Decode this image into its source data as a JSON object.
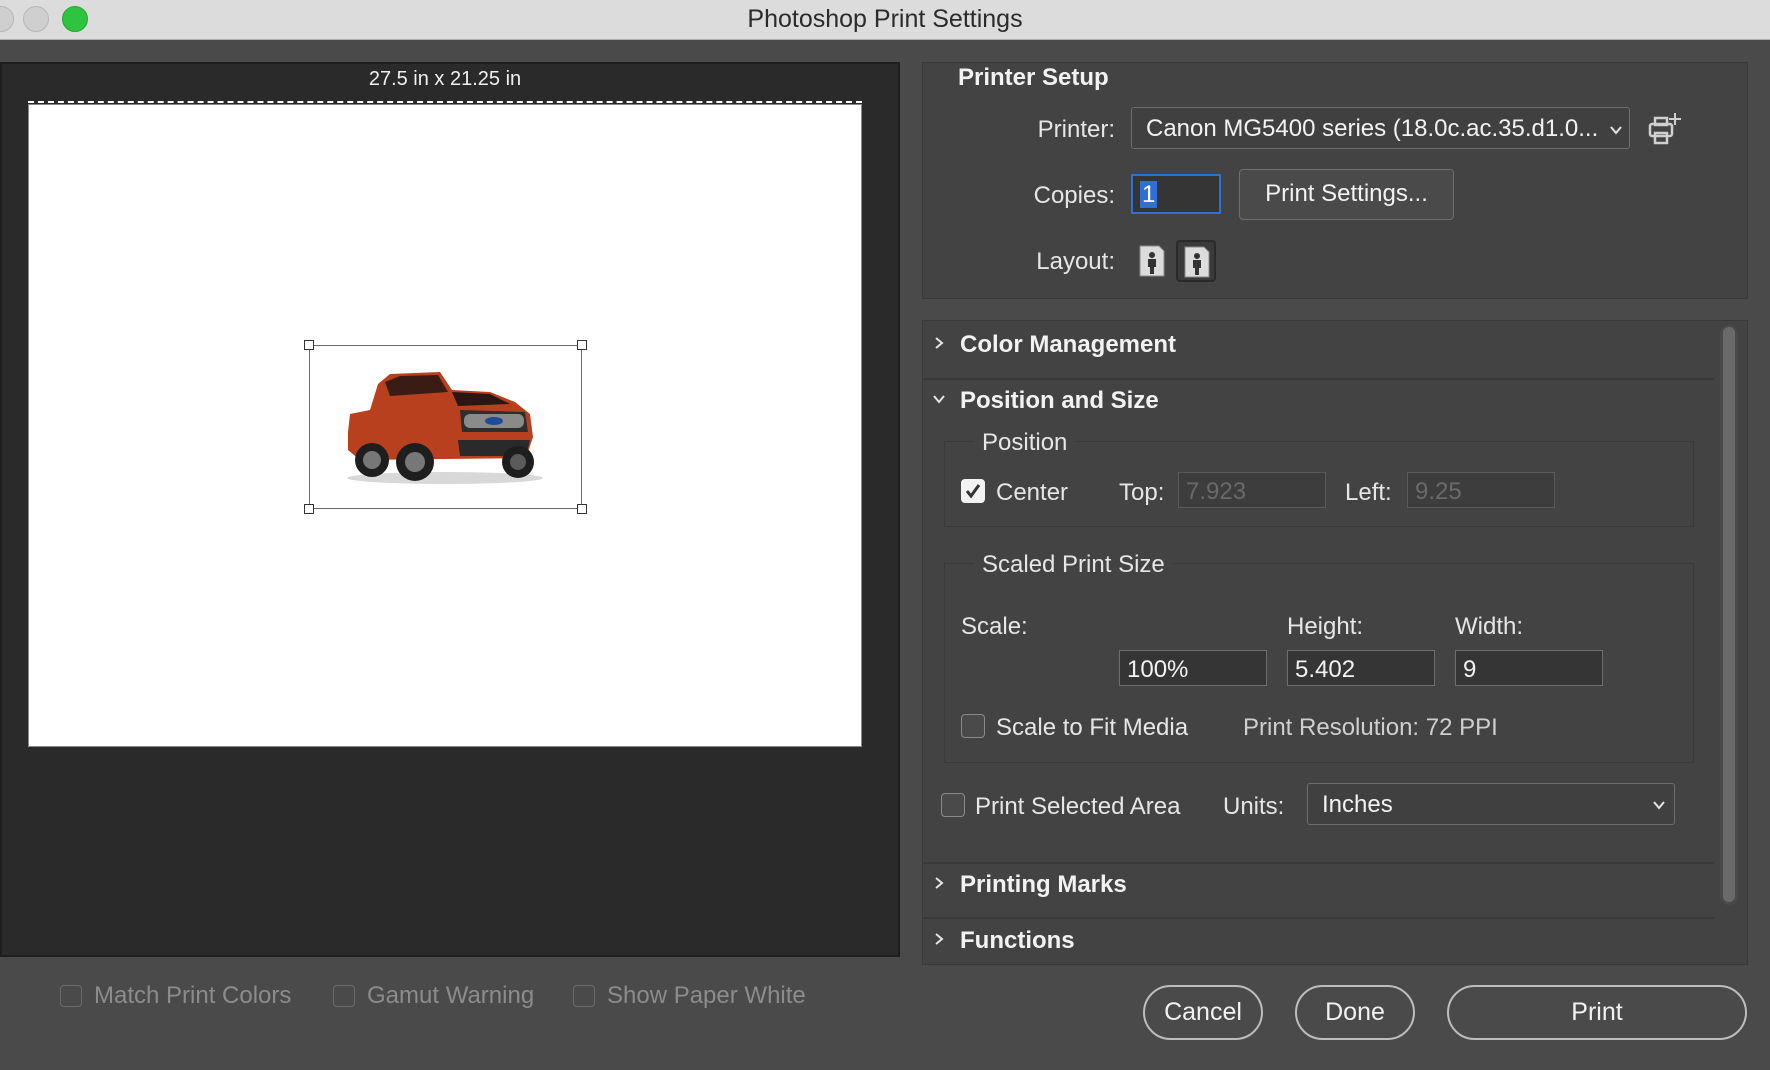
{
  "window": {
    "title": "Photoshop Print Settings"
  },
  "preview": {
    "paper_size": "27.5 in x 21.25 in",
    "image_description": "red pickup truck"
  },
  "bottom_options": [
    {
      "label": "Match Print Colors",
      "checked": false,
      "enabled": false
    },
    {
      "label": "Gamut Warning",
      "checked": false,
      "enabled": false
    },
    {
      "label": "Show Paper White",
      "checked": false,
      "enabled": false
    }
  ],
  "printer_setup": {
    "title": "Printer Setup",
    "printer_label": "Printer:",
    "printer_value": "Canon MG5400 series (18.0c.ac.35.d1.0...",
    "copies_label": "Copies:",
    "copies_value": "1",
    "print_settings_button": "Print Settings...",
    "layout_label": "Layout:"
  },
  "sections": {
    "color_management": "Color Management",
    "position_and_size": "Position and Size",
    "printing_marks": "Printing Marks",
    "functions": "Functions"
  },
  "position": {
    "title": "Position",
    "center_label": "Center",
    "center_checked": true,
    "top_label": "Top:",
    "top_value": "7.923",
    "left_label": "Left:",
    "left_value": "9.25"
  },
  "scaled": {
    "title": "Scaled Print Size",
    "scale_label": "Scale:",
    "height_label": "Height:",
    "width_label": "Width:",
    "scale_value": "100%",
    "height_value": "5.402",
    "width_value": "9",
    "fit_label": "Scale to Fit Media",
    "fit_checked": false,
    "resolution": "Print Resolution: 72 PPI"
  },
  "selected_area": {
    "label": "Print Selected Area",
    "checked": false,
    "units_label": "Units:",
    "units_value": "Inches"
  },
  "buttons": {
    "cancel": "Cancel",
    "done": "Done",
    "print": "Print"
  },
  "colors": {
    "accent": "#2f6fd6",
    "green": "#2ec43f",
    "truck": "#b8401e"
  }
}
